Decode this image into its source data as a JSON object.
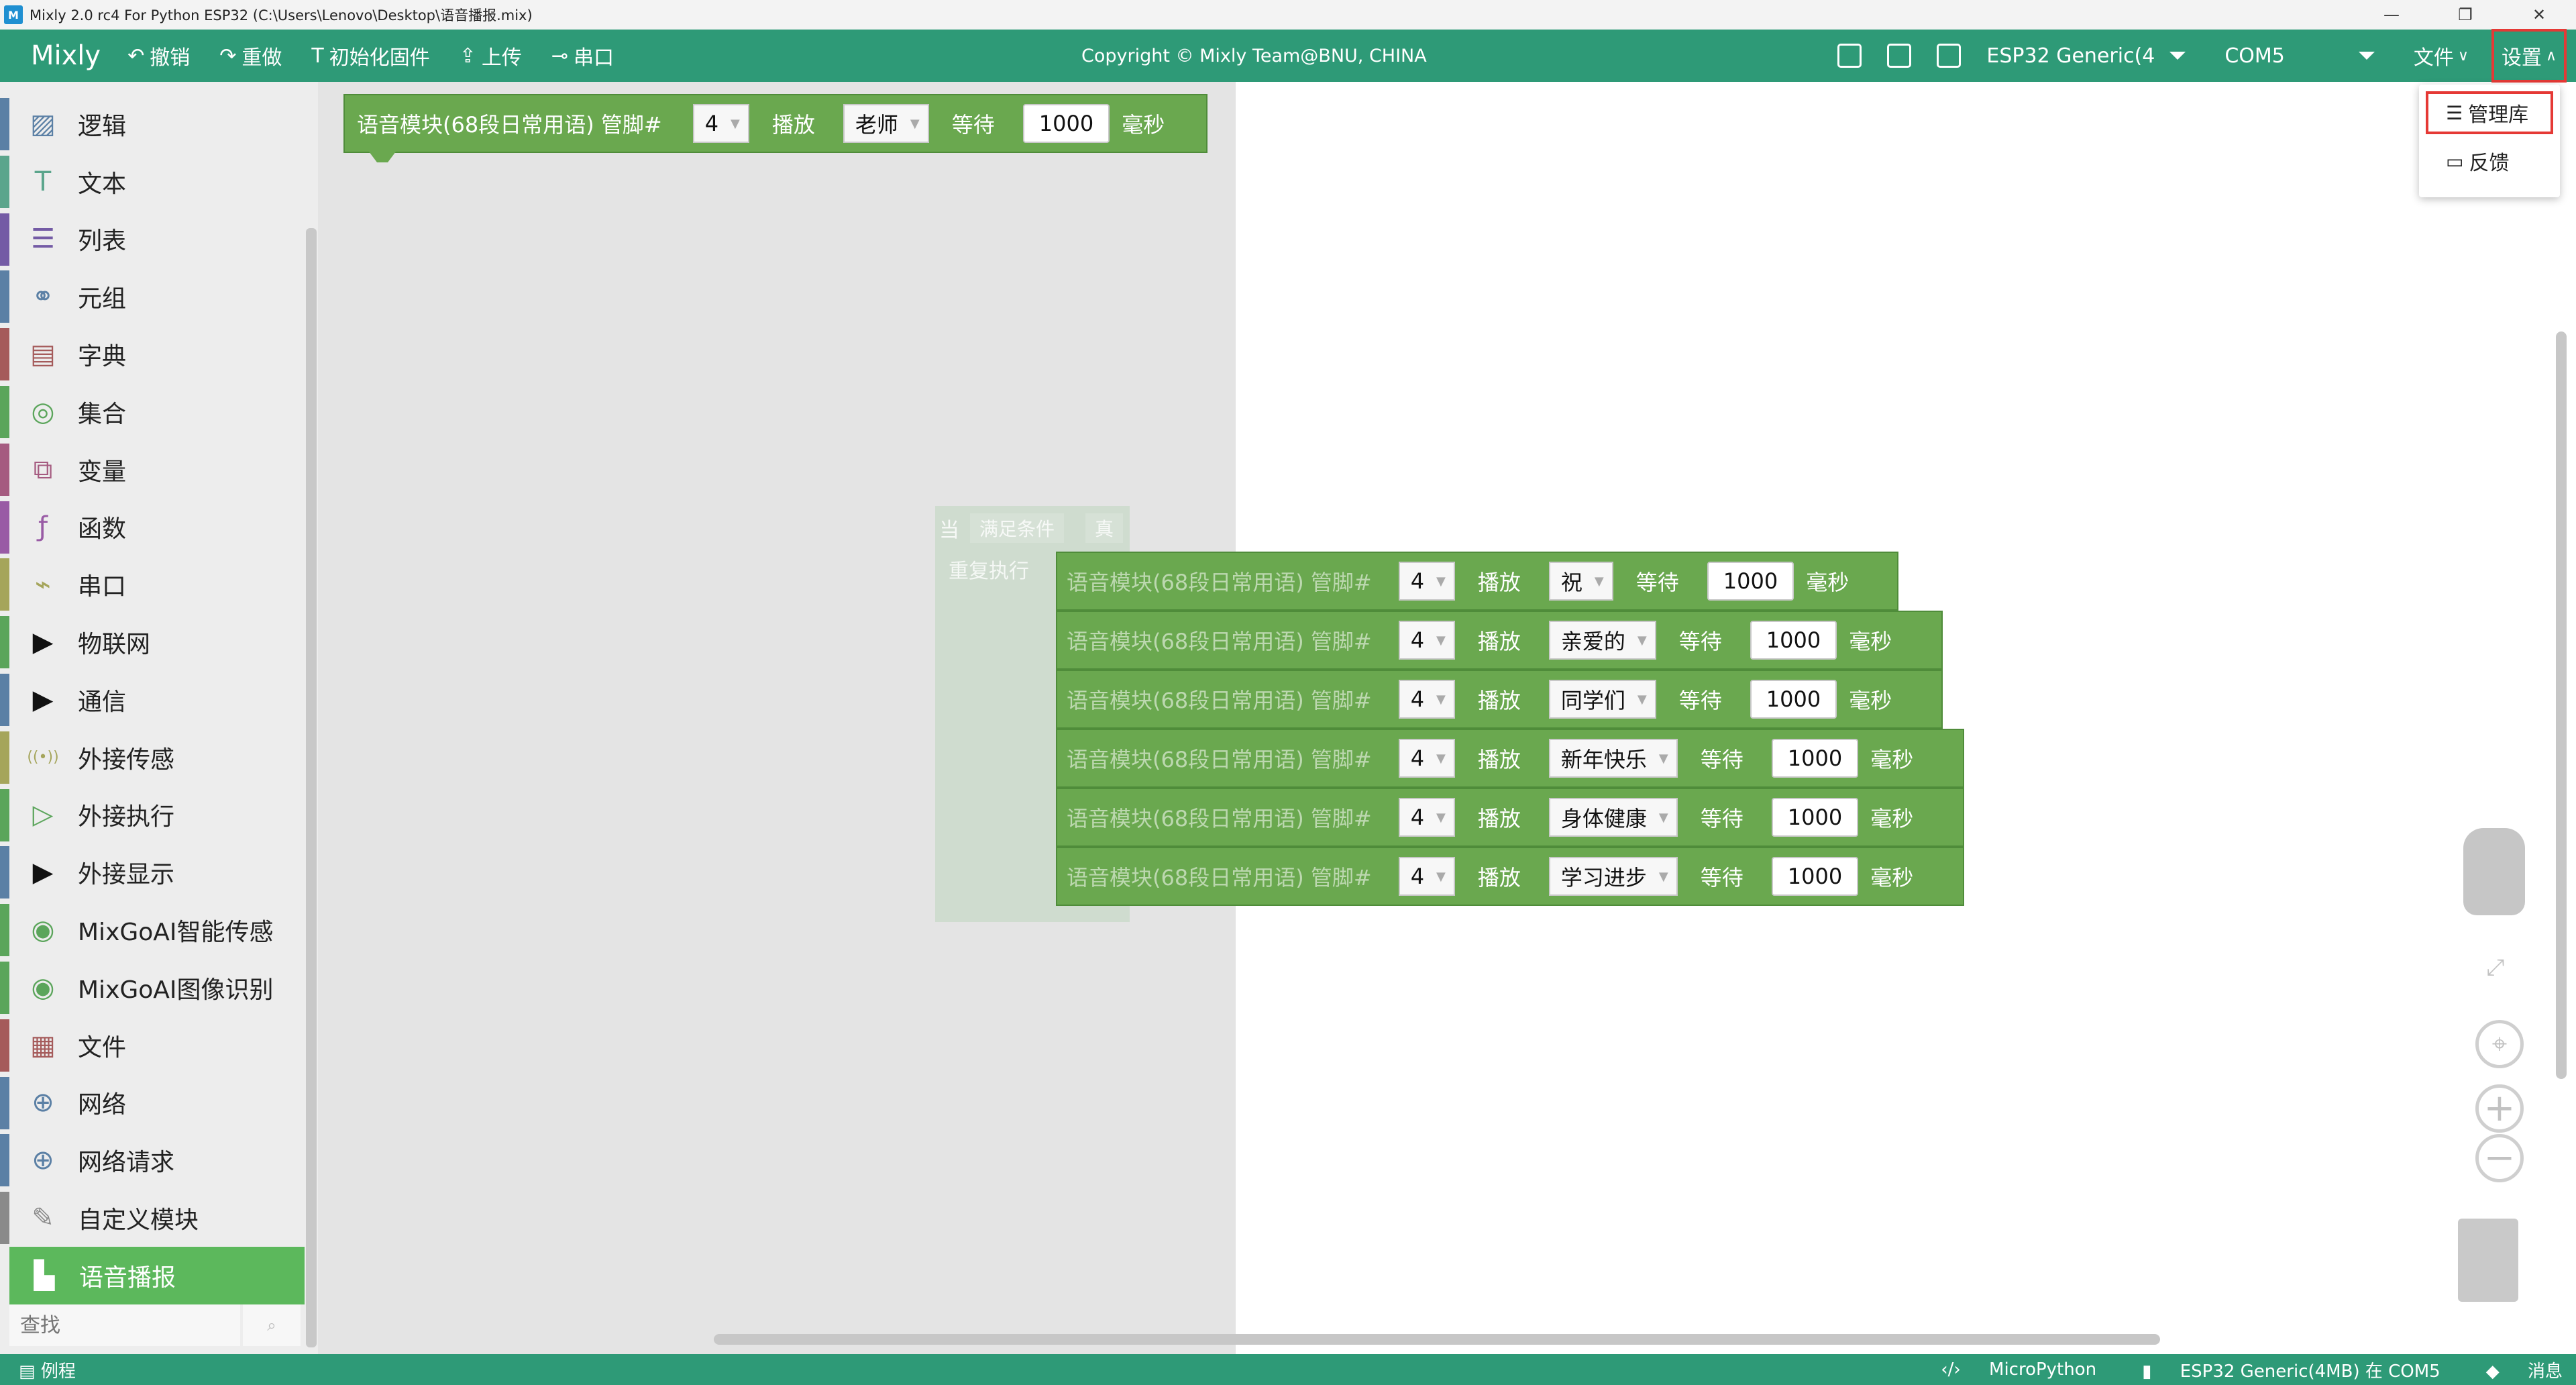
{
  "window": {
    "title": "Mixly 2.0 rc4 For Python ESP32 (C:\\Users\\Lenovo\\Desktop\\语音播报.mix)",
    "app_icon_text": "M"
  },
  "menubar": {
    "brand": "Mixly",
    "undo": "撤销",
    "redo": "重做",
    "init_firmware": "初始化固件",
    "upload": "上传",
    "serial": "串口",
    "copyright": "Copyright © Mixly Team@BNU, CHINA",
    "board": "ESP32 Generic(4",
    "port": "COM5",
    "file_menu": "文件",
    "settings_menu": "设置"
  },
  "settings_dropdown": {
    "items": [
      {
        "label": "管理库",
        "icon": "menu-lines-icon"
      },
      {
        "label": "反馈",
        "icon": "feedback-icon"
      }
    ]
  },
  "toolbox": {
    "categories": [
      {
        "label": "逻辑",
        "icon": "logic-icon",
        "color": "#5b80a5"
      },
      {
        "label": "文本",
        "icon": "text-icon",
        "color": "#5ba58c"
      },
      {
        "label": "列表",
        "icon": "list-icon",
        "color": "#745ba5"
      },
      {
        "label": "元组",
        "icon": "tuple-icon",
        "color": "#5b80a5"
      },
      {
        "label": "字典",
        "icon": "dict-icon",
        "color": "#a55b5b"
      },
      {
        "label": "集合",
        "icon": "set-icon",
        "color": "#5ba55b"
      },
      {
        "label": "变量",
        "icon": "variable-icon",
        "color": "#a55b80"
      },
      {
        "label": "函数",
        "icon": "function-icon",
        "color": "#995ba5"
      },
      {
        "label": "串口",
        "icon": "serial-icon",
        "color": "#a5a55b"
      },
      {
        "label": "物联网",
        "icon": "expand-triangle-icon",
        "color": "#5ba55b"
      },
      {
        "label": "通信",
        "icon": "expand-triangle-icon",
        "color": "#5b80a5"
      },
      {
        "label": "外接传感",
        "icon": "sensor-icon",
        "color": "#a5a55b"
      },
      {
        "label": "外接执行",
        "icon": "actuator-icon",
        "color": "#5ba55b"
      },
      {
        "label": "外接显示",
        "icon": "expand-triangle-icon",
        "color": "#5b80a5"
      },
      {
        "label": "MixGoAI智能传感",
        "icon": "eye-icon",
        "color": "#5ba55b"
      },
      {
        "label": "MixGoAI图像识别",
        "icon": "eye-icon",
        "color": "#5ba55b"
      },
      {
        "label": "文件",
        "icon": "file-icon",
        "color": "#a55b5b"
      },
      {
        "label": "网络",
        "icon": "globe-icon",
        "color": "#5b80a5"
      },
      {
        "label": "网络请求",
        "icon": "globe-icon",
        "color": "#5b80a5"
      },
      {
        "label": "自定义模块",
        "icon": "pen-icon",
        "color": "#8a8a8a"
      },
      {
        "label": "语音播报",
        "icon": "speaker-block-icon",
        "color": "#5cb85c",
        "selected": true
      }
    ],
    "search_placeholder": "查找"
  },
  "flyout_block": {
    "label": "语音模块(68段日常用语) 管脚#",
    "pin": "4",
    "play_label": "播放",
    "phrase": "老师",
    "wait_label": "等待",
    "ms": "1000",
    "unit": "毫秒"
  },
  "loop_block": {
    "when": "当",
    "condition": "满足条件",
    "value": "真",
    "do_label": "重复执行"
  },
  "workspace_blocks": [
    {
      "label": "语音模块(68段日常用语) 管脚#",
      "pin": "4",
      "play_label": "播放",
      "phrase": "祝",
      "wait_label": "等待",
      "ms": "1000",
      "unit": "毫秒"
    },
    {
      "label": "语音模块(68段日常用语) 管脚#",
      "pin": "4",
      "play_label": "播放",
      "phrase": "亲爱的",
      "wait_label": "等待",
      "ms": "1000",
      "unit": "毫秒"
    },
    {
      "label": "语音模块(68段日常用语) 管脚#",
      "pin": "4",
      "play_label": "播放",
      "phrase": "同学们",
      "wait_label": "等待",
      "ms": "1000",
      "unit": "毫秒"
    },
    {
      "label": "语音模块(68段日常用语) 管脚#",
      "pin": "4",
      "play_label": "播放",
      "phrase": "新年快乐",
      "wait_label": "等待",
      "ms": "1000",
      "unit": "毫秒"
    },
    {
      "label": "语音模块(68段日常用语) 管脚#",
      "pin": "4",
      "play_label": "播放",
      "phrase": "身体健康",
      "wait_label": "等待",
      "ms": "1000",
      "unit": "毫秒"
    },
    {
      "label": "语音模块(68段日常用语) 管脚#",
      "pin": "4",
      "play_label": "播放",
      "phrase": "学习进步",
      "wait_label": "等待",
      "ms": "1000",
      "unit": "毫秒"
    }
  ],
  "statusbar": {
    "examples": "例程",
    "language": "MicroPython",
    "board_status": "ESP32 Generic(4MB) 在 COM5",
    "messages": "消息"
  },
  "colors": {
    "accent": "#2e9a77",
    "block_green": "#6aa84f",
    "highlight_red": "#e53935"
  }
}
